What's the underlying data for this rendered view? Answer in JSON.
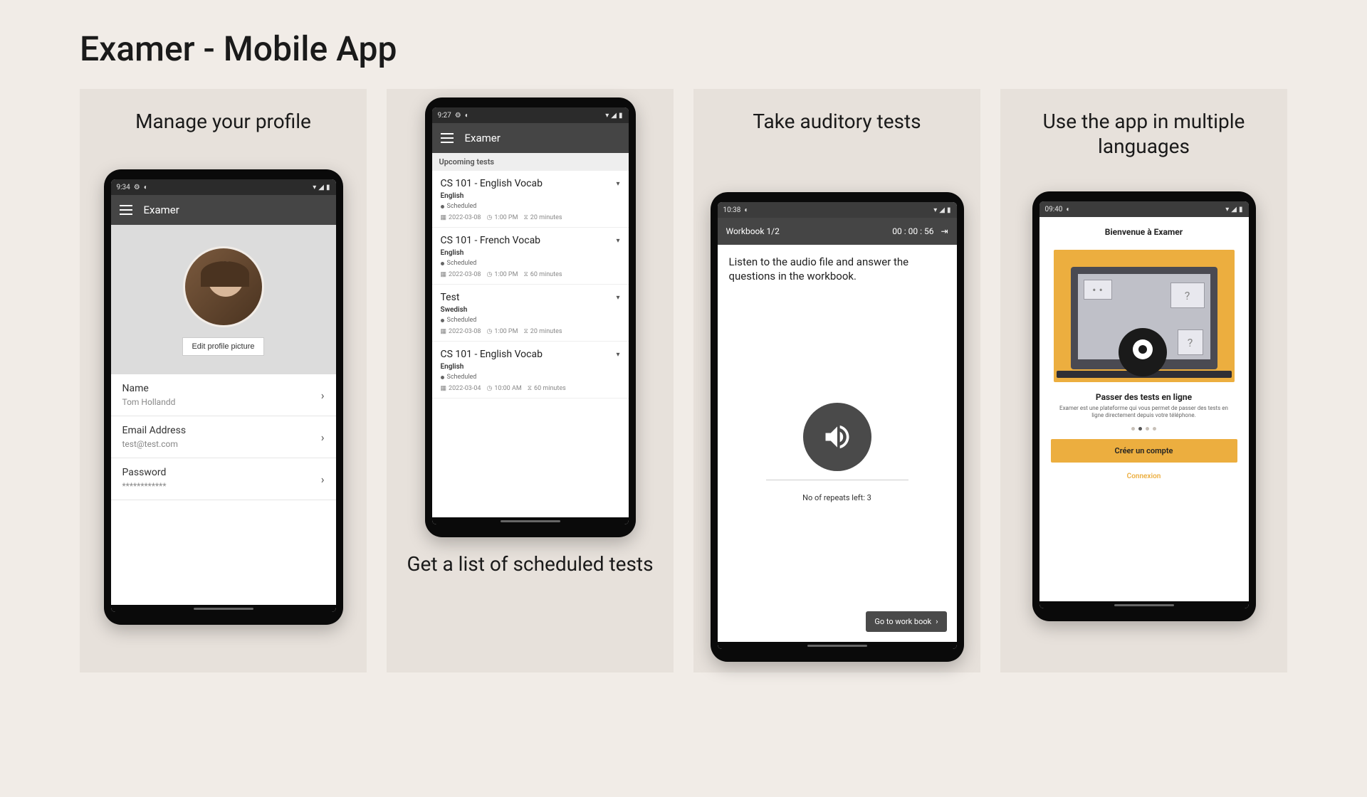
{
  "page_title": "Examer - Mobile App",
  "cards": {
    "c1": {
      "caption": "Manage your profile",
      "status_time": "9:34",
      "app_title": "Examer",
      "edit_label": "Edit profile picture",
      "fields": [
        {
          "label": "Name",
          "value": "Tom Hollandd"
        },
        {
          "label": "Email Address",
          "value": "test@test.com"
        },
        {
          "label": "Password",
          "value": "************"
        }
      ]
    },
    "c2": {
      "caption": "Get a list of scheduled tests",
      "status_time": "9:27",
      "app_title": "Examer",
      "section": "Upcoming tests",
      "tests": [
        {
          "title": "CS 101 - English Vocab",
          "lang": "English",
          "status": "Scheduled",
          "date": "2022-03-08",
          "time": "1:00 PM",
          "dur": "20 minutes"
        },
        {
          "title": "CS 101 - French Vocab",
          "lang": "English",
          "status": "Scheduled",
          "date": "2022-03-08",
          "time": "1:00 PM",
          "dur": "60 minutes"
        },
        {
          "title": "Test",
          "lang": "Swedish",
          "status": "Scheduled",
          "date": "2022-03-08",
          "time": "1:00 PM",
          "dur": "20 minutes"
        },
        {
          "title": "CS 101 - English Vocab",
          "lang": "English",
          "status": "Scheduled",
          "date": "2022-03-04",
          "time": "10:00 AM",
          "dur": "60 minutes"
        }
      ]
    },
    "c3": {
      "caption": "Take auditory tests",
      "status_time": "10:38",
      "workbook": "Workbook 1/2",
      "timer": "00 : 00 : 56",
      "instruction": "Listen to the audio file and answer the questions in the workbook.",
      "repeats": "No of repeats left: 3",
      "goto": "Go to work book"
    },
    "c4": {
      "caption": "Use the app in multiple languages",
      "status_time": "09:40",
      "welcome": "Bienvenue à Examer",
      "onb_title": "Passer des tests en ligne",
      "onb_desc": "Examer est une plateforme qui vous permet de passer des tests en ligne directement depuis votre téléphone.",
      "create": "Créer un compte",
      "login": "Connexion"
    }
  }
}
